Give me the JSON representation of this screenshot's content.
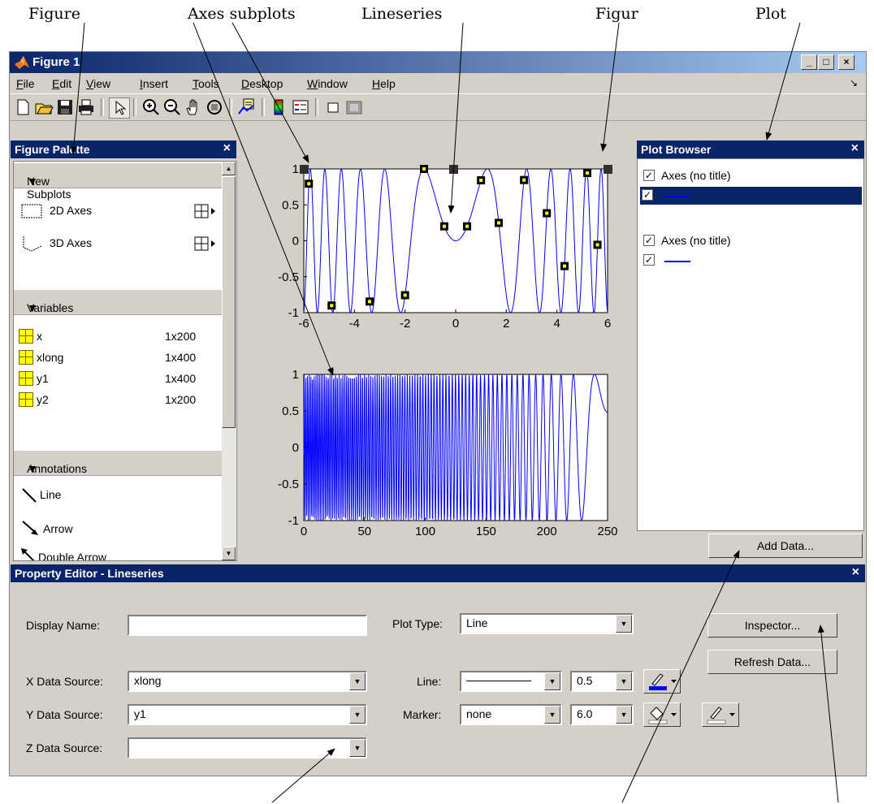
{
  "callouts": {
    "figure": "Figure",
    "axes_subplots": "Axes subplots",
    "lineseries": "Lineseries",
    "figur": "Figur",
    "plot": "Plot"
  },
  "window": {
    "title": "Figure 1",
    "min": "_",
    "max": "□",
    "close": "×"
  },
  "menubar": {
    "items": [
      {
        "label": "File",
        "u": "F",
        "rest": "ile"
      },
      {
        "label": "Edit",
        "u": "E",
        "rest": "dit"
      },
      {
        "label": "View",
        "u": "V",
        "rest": "iew"
      },
      {
        "label": "Insert",
        "u": "I",
        "rest": "nsert"
      },
      {
        "label": "Tools",
        "u": "T",
        "rest": "ools"
      },
      {
        "label": "Desktop",
        "u": "D",
        "rest": "esktop"
      },
      {
        "label": "Window",
        "u": "W",
        "rest": "indow"
      },
      {
        "label": "Help",
        "u": "H",
        "rest": "elp"
      }
    ]
  },
  "toolbar": {
    "icons": [
      "new-file-icon",
      "open-folder-icon",
      "save-icon",
      "print-icon",
      "select-arrow-icon",
      "zoom-in-icon",
      "zoom-out-icon",
      "pan-hand-icon",
      "rotate-3d-icon",
      "data-cursor-icon",
      "colorbar-icon",
      "legend-icon",
      "hide-plot-tools-icon",
      "show-plot-tools-icon"
    ]
  },
  "figure_palette": {
    "title": "Figure Palette",
    "close": "×",
    "new_subplots": {
      "header": "New Subplots",
      "items": [
        "2D Axes",
        "3D Axes"
      ]
    },
    "variables": {
      "header": "Variables",
      "items": [
        {
          "name": "x",
          "size": "1x200"
        },
        {
          "name": "xlong",
          "size": "1x400"
        },
        {
          "name": "y1",
          "size": "1x400"
        },
        {
          "name": "y2",
          "size": "1x200"
        }
      ]
    },
    "annotations": {
      "header": "Annotations",
      "items": [
        "Line",
        "Arrow",
        "Double Arrow"
      ]
    }
  },
  "plots": {
    "top": {
      "xticks": [
        "-6",
        "-4",
        "-2",
        "0",
        "2",
        "4",
        "6"
      ],
      "yticks": [
        "1",
        "0.5",
        "0",
        "-0.5",
        "-1"
      ],
      "xlim": [
        -6,
        6
      ],
      "ylim": [
        -1,
        1
      ]
    },
    "bottom": {
      "xticks": [
        "0",
        "50",
        "100",
        "150",
        "200",
        "250"
      ],
      "yticks": [
        "1",
        "0.5",
        "0",
        "-0.5",
        "-1"
      ],
      "xlim": [
        0,
        250
      ],
      "ylim": [
        -1,
        1
      ]
    }
  },
  "plot_browser": {
    "title": "Plot Browser",
    "close": "×",
    "axes1_label": "Axes (no title)",
    "axes2_label": "Axes (no title)",
    "add_data": "Add Data..."
  },
  "property_editor": {
    "title": "Property Editor - Lineseries",
    "close": "×",
    "display_name_label": "Display Name:",
    "display_name_value": "",
    "x_source_label": "X Data Source:",
    "x_source_value": "xlong",
    "y_source_label": "Y Data Source:",
    "y_source_value": "y1",
    "z_source_label": "Z Data Source:",
    "z_source_value": "",
    "plot_type_label": "Plot Type:",
    "plot_type_value": "Line",
    "line_label": "Line:",
    "line_width_value": "0.5",
    "marker_label": "Marker:",
    "marker_value": "none",
    "marker_size_value": "6.0",
    "inspector_button": "Inspector...",
    "refresh_button": "Refresh Data..."
  },
  "colors": {
    "title_bar": "#0a246a",
    "panel_bg": "#d4d0c8",
    "line": "#0000ff"
  }
}
